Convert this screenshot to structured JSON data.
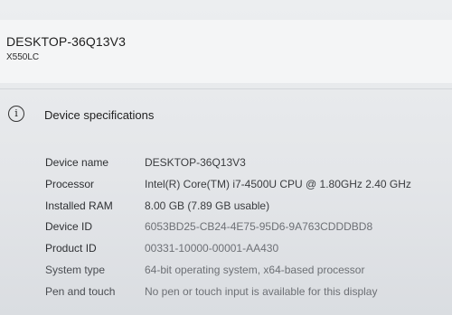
{
  "device": {
    "title": "DESKTOP-36Q13V3",
    "model": "X550LC"
  },
  "specifications": {
    "header": "Device specifications",
    "icon": "info-icon",
    "rows": [
      {
        "label": "Device name",
        "value": "DESKTOP-36Q13V3"
      },
      {
        "label": "Processor",
        "value": "Intel(R) Core(TM) i7-4500U CPU @ 1.80GHz   2.40 GHz"
      },
      {
        "label": "Installed RAM",
        "value": "8.00 GB (7.89 GB usable)"
      },
      {
        "label": "Device ID",
        "value": "6053BD25-CB24-4E75-95D6-9A763CDDDBD8"
      },
      {
        "label": "Product ID",
        "value": "00331-10000-00001-AA430"
      },
      {
        "label": "System type",
        "value": "64-bit operating system, x64-based processor"
      },
      {
        "label": "Pen and touch",
        "value": "No pen or touch input is available for this display"
      }
    ]
  }
}
